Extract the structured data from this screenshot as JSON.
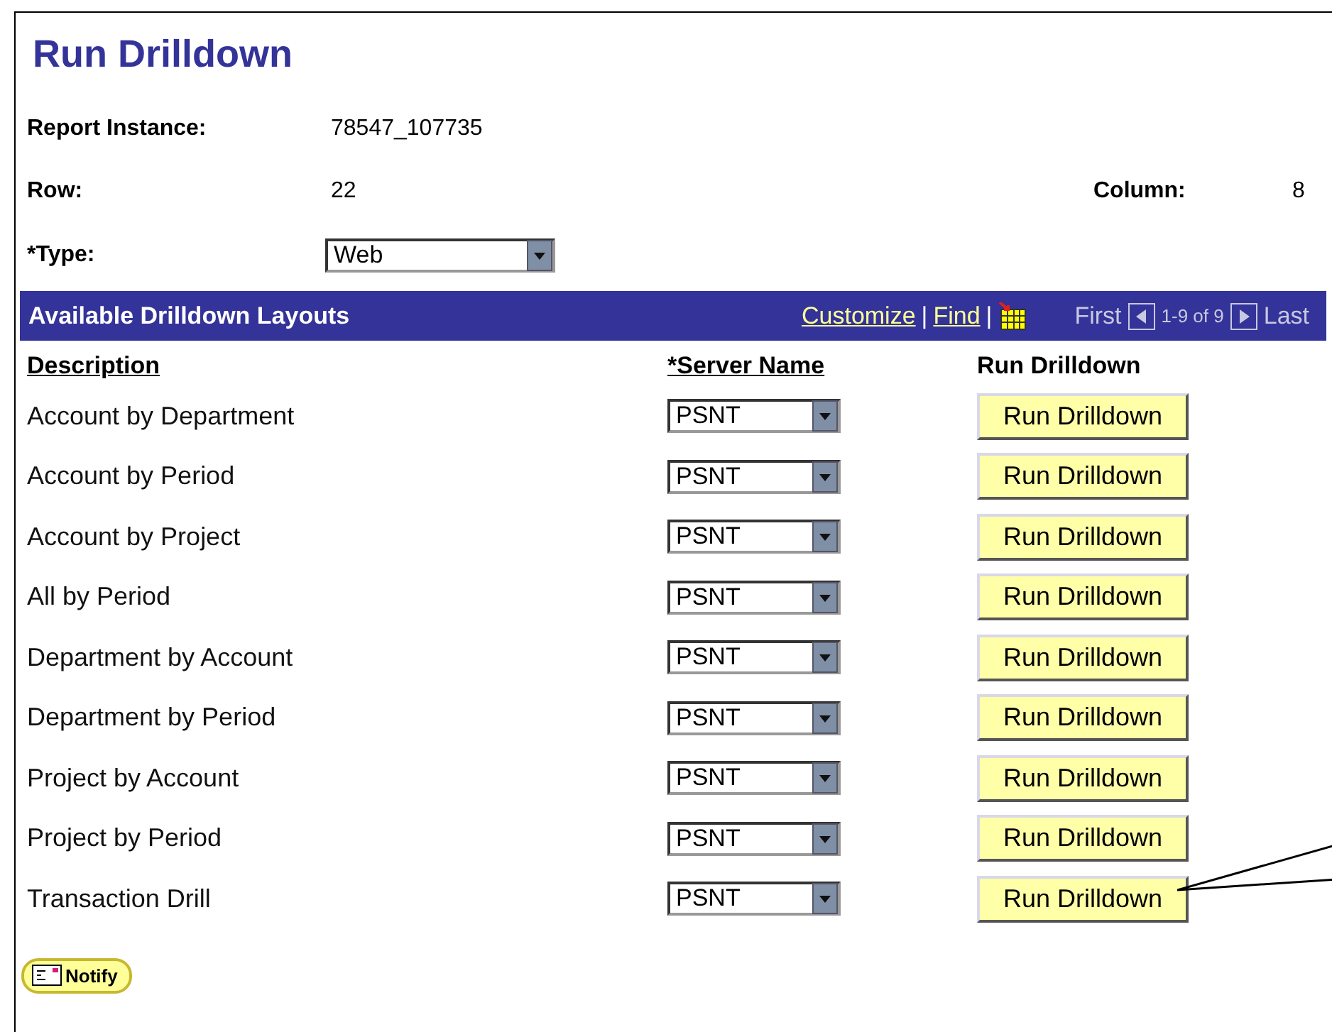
{
  "title": "Run Drilldown",
  "fields": {
    "report_instance": {
      "label": "Report Instance:",
      "value": "78547_107735"
    },
    "row": {
      "label": "Row:",
      "value": "22"
    },
    "column": {
      "label": "Column:",
      "value": "8"
    },
    "type": {
      "label": "*Type:",
      "value": "Web"
    }
  },
  "grid": {
    "title": "Available Drilldown Layouts",
    "links": [
      "Customize",
      "Find"
    ],
    "separator": "|",
    "nav": {
      "first": "First",
      "range": "1-9 of 9",
      "last": "Last",
      "disabled": true
    },
    "columns": [
      "Description",
      "*Server Name",
      "Run Drilldown"
    ],
    "rows": [
      {
        "description": "Account by Department",
        "server": "PSNT",
        "button": "Run Drilldown"
      },
      {
        "description": "Account by Period",
        "server": "PSNT",
        "button": "Run Drilldown"
      },
      {
        "description": "Account by Project",
        "server": "PSNT",
        "button": "Run Drilldown"
      },
      {
        "description": "All by Period",
        "server": "PSNT",
        "button": "Run Drilldown"
      },
      {
        "description": "Department by Account",
        "server": "PSNT",
        "button": "Run Drilldown"
      },
      {
        "description": "Department by Period",
        "server": "PSNT",
        "button": "Run Drilldown"
      },
      {
        "description": "Project by Account",
        "server": "PSNT",
        "button": "Run Drilldown"
      },
      {
        "description": "Project by Period",
        "server": "PSNT",
        "button": "Run Drilldown"
      },
      {
        "description": "Transaction Drill",
        "server": "PSNT",
        "button": "Run Drilldown"
      }
    ]
  },
  "notify": "Notify"
}
